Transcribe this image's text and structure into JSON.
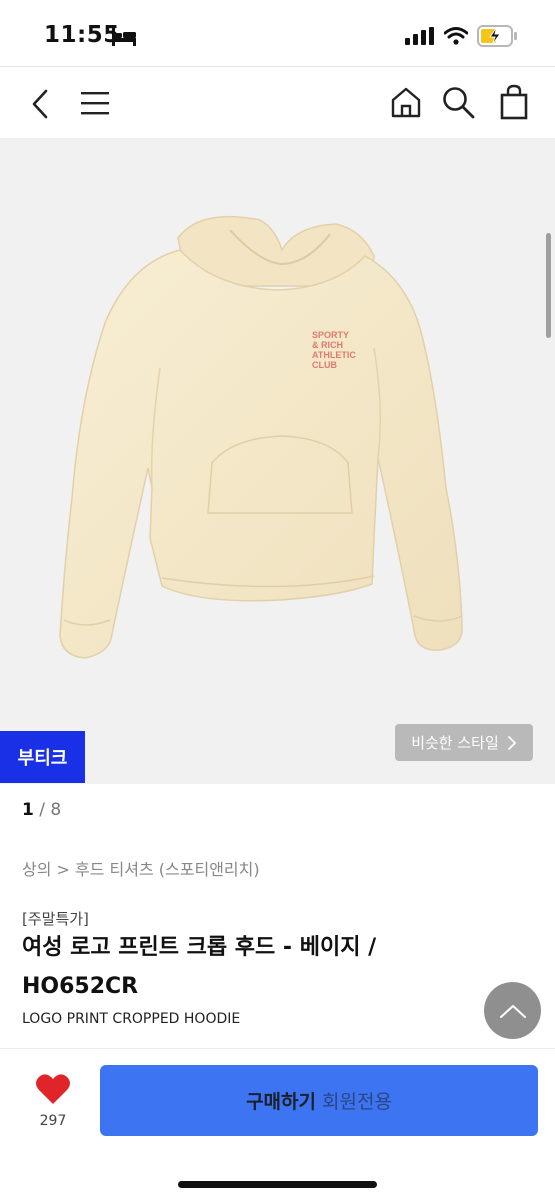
{
  "status_bar": {
    "time": "11:55"
  },
  "icons": {
    "back": "chevron-left-icon",
    "menu": "hamburger-icon",
    "home": "home-icon",
    "search": "search-icon",
    "cart": "shopping-bag-icon",
    "like": "heart-icon",
    "scroll_top": "chevron-up-icon"
  },
  "gallery": {
    "badge": "부티크",
    "similar_style": "비슷한 스타일",
    "current": "1",
    "separator": "/",
    "total": "8",
    "print_text": [
      "SPORTY",
      "& RICH",
      "ATHLETIC",
      "CLUB"
    ]
  },
  "product": {
    "breadcrumb": "상의 > 후드 티셔츠 (스포티앤리치)",
    "promo_tag": "[주말특가]",
    "title": "여성 로고 프린트 크롭 후드 - 베이지 / HO652CR",
    "subtitle": "LOGO PRINT CROPPED HOODIE"
  },
  "footer": {
    "like_count": "297",
    "buy_label": "구매하기",
    "buy_sub": "회원전용"
  },
  "colors": {
    "accent": "#3d74f2",
    "badge": "#1a30e6",
    "heart": "#e0252a",
    "hoodie": "#f7ecd0"
  }
}
